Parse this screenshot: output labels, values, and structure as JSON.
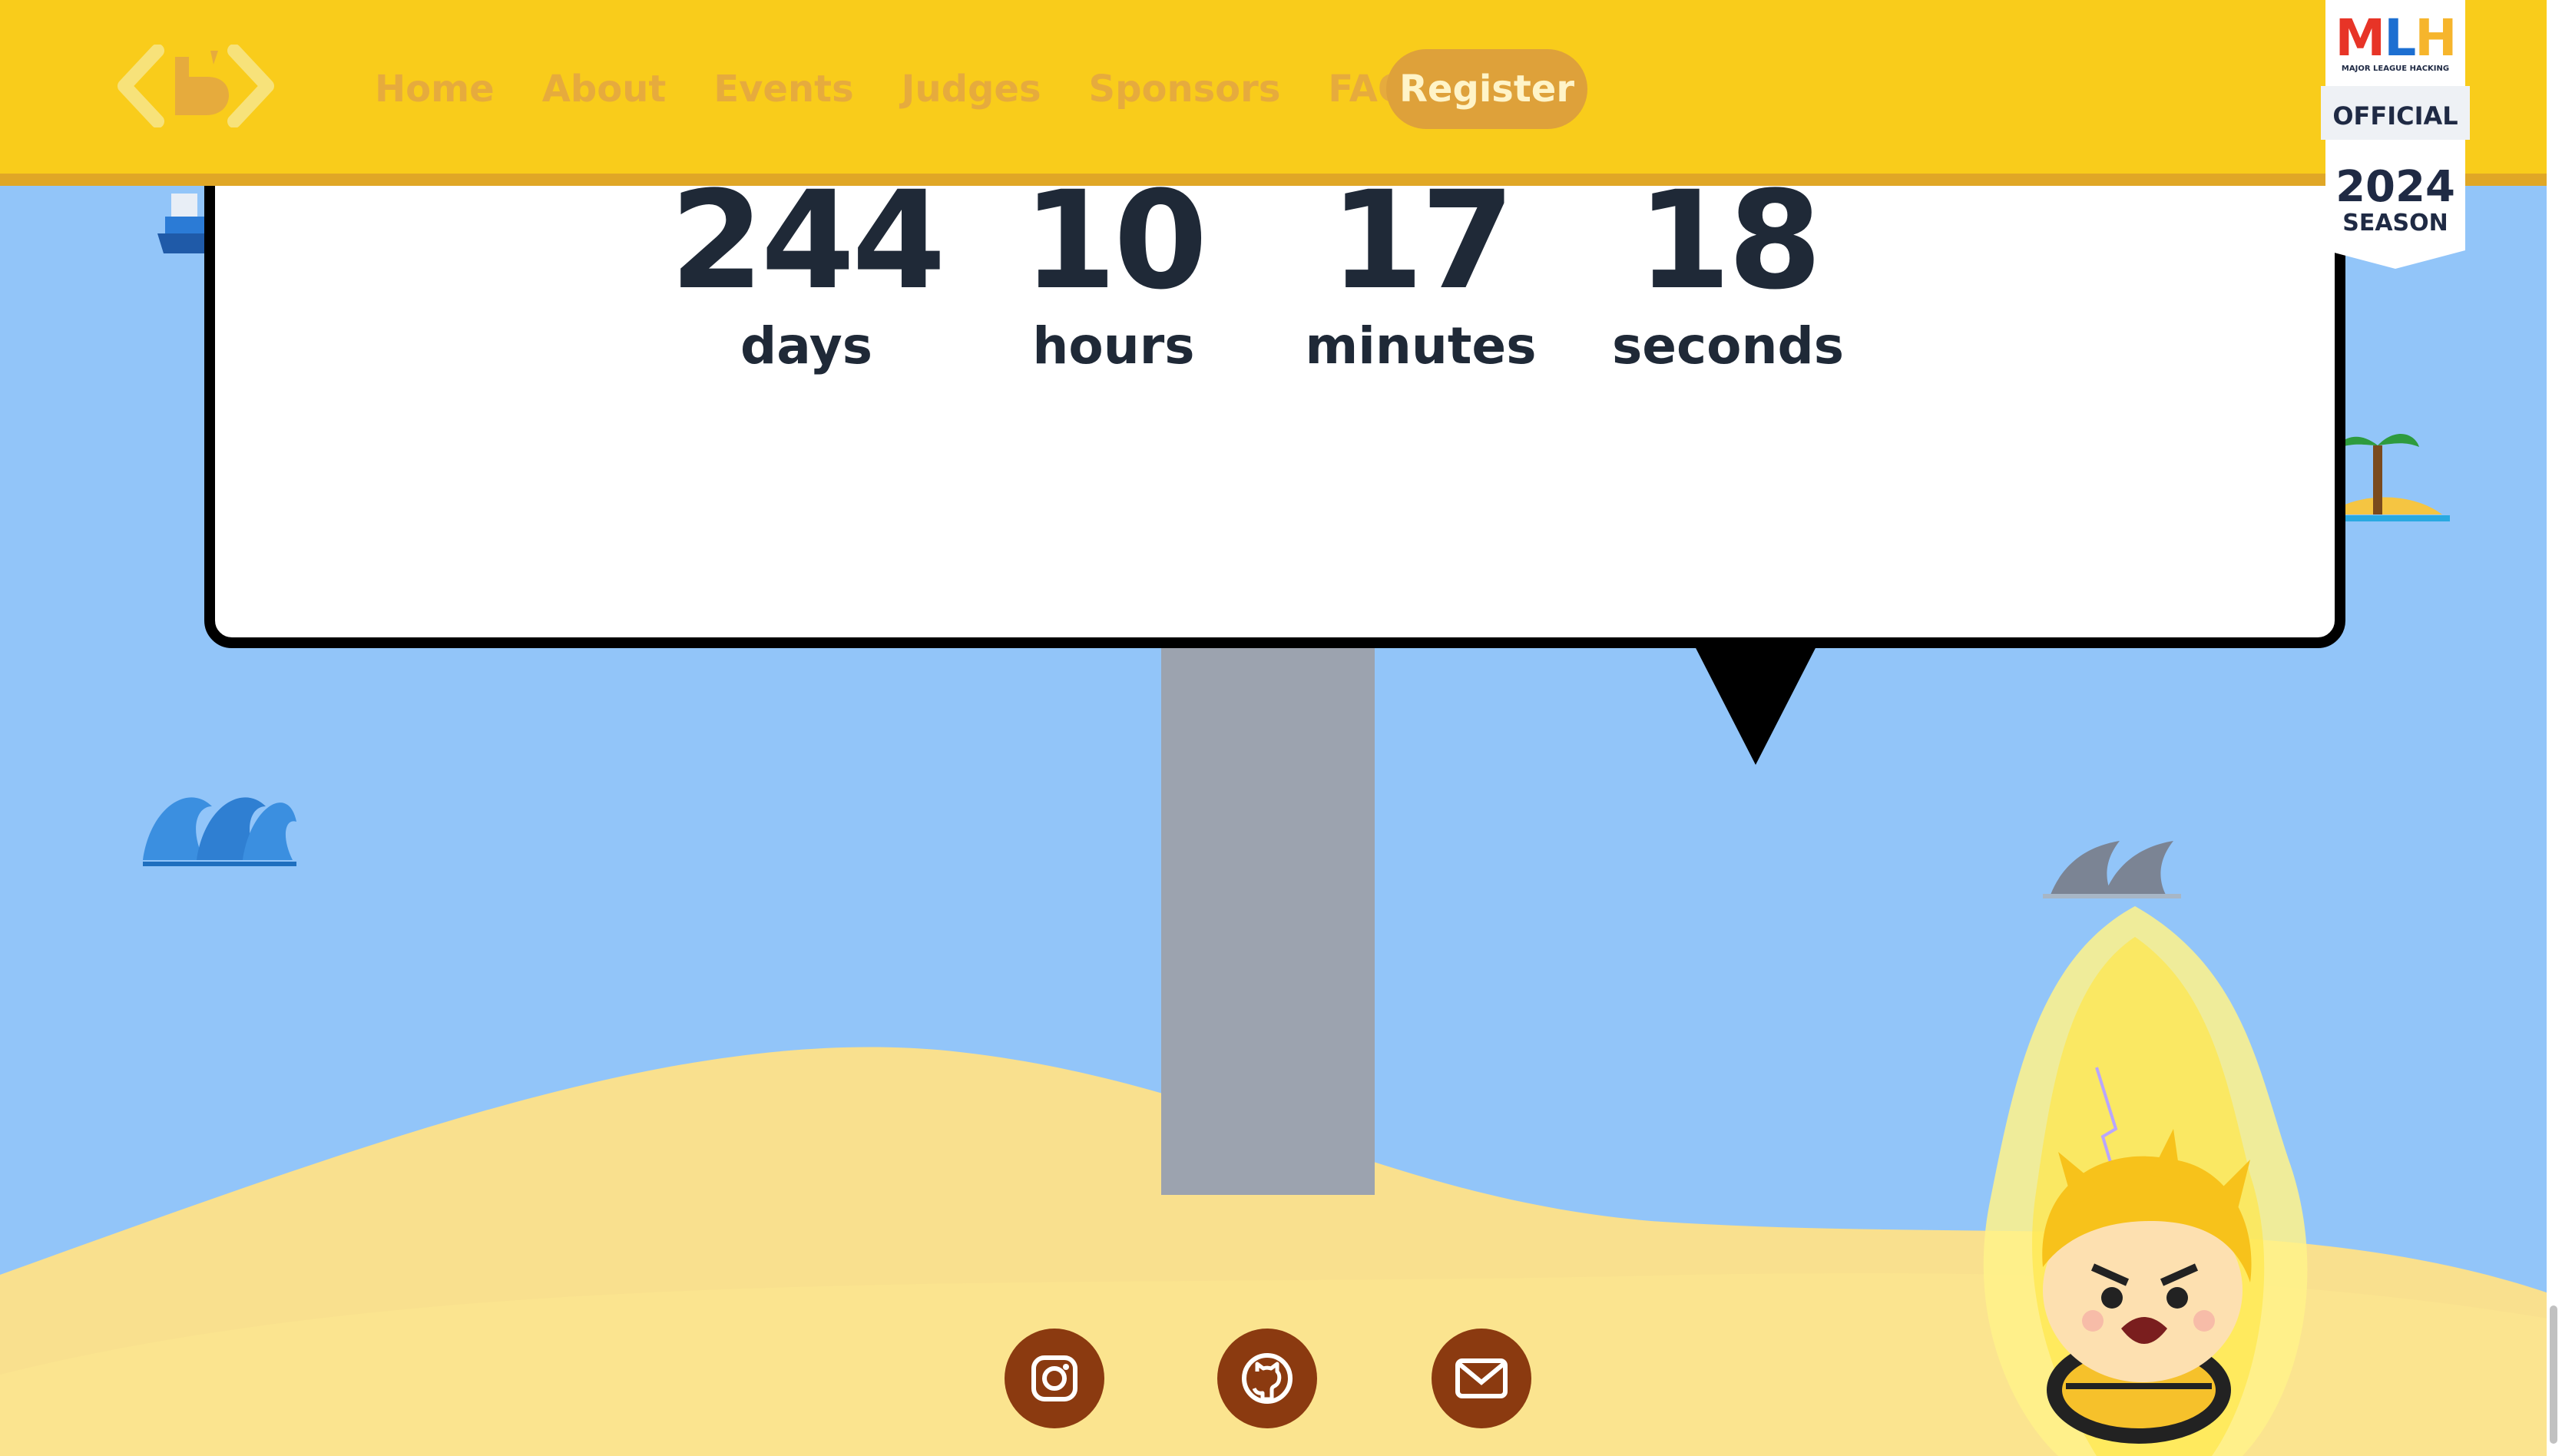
{
  "nav": {
    "logo_icon": "brackets-b-logo-icon",
    "links": [
      "Home",
      "About",
      "Events",
      "Judges",
      "Sponsors",
      "FAQ"
    ],
    "register_label": "Register"
  },
  "mlh_badge": {
    "logo_text": "MLH",
    "tagline": "MAJOR LEAGUE HACKING",
    "official": "OFFICIAL",
    "year": "2024",
    "season": "SEASON"
  },
  "countdown": {
    "days": {
      "value": "244",
      "label": "days"
    },
    "hours": {
      "value": "10",
      "label": "hours"
    },
    "minutes": {
      "value": "17",
      "label": "minutes"
    },
    "seconds": {
      "value": "18",
      "label": "seconds"
    }
  },
  "social": [
    {
      "icon": "instagram-icon"
    },
    {
      "icon": "github-icon"
    },
    {
      "icon": "mail-icon"
    }
  ],
  "colors": {
    "sky": "#92c5f9",
    "nav": "#f9cc1b",
    "nav_link": "#e6ab3d",
    "sand": "#fae38e",
    "social_bg": "#8b3a10",
    "text_dark": "#1f2937"
  }
}
